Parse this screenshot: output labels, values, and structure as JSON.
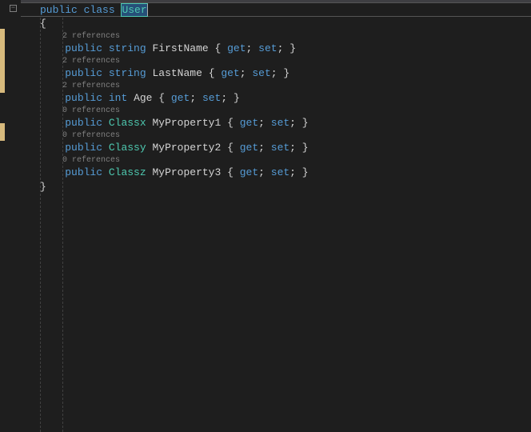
{
  "classDecl": {
    "kw_public": "public",
    "kw_class": "class",
    "name": "User"
  },
  "braceOpen": "{",
  "braceClose": "}",
  "properties": [
    {
      "refs": "2 references",
      "access": "public",
      "type": "string",
      "typeClass": "type",
      "name": "FirstName",
      "get": "get",
      "set": "set"
    },
    {
      "refs": "2 references",
      "access": "public",
      "type": "string",
      "typeClass": "type",
      "name": "LastName",
      "get": "get",
      "set": "set"
    },
    {
      "refs": "2 references",
      "access": "public",
      "type": "int",
      "typeClass": "type",
      "name": "Age",
      "get": "get",
      "set": "set"
    },
    {
      "refs": "0 references",
      "access": "public",
      "type": "Classx",
      "typeClass": "cls",
      "name": "MyProperty1",
      "get": "get",
      "set": "set"
    },
    {
      "refs": "0 references",
      "access": "public",
      "type": "Classy",
      "typeClass": "cls",
      "name": "MyProperty2",
      "get": "get",
      "set": "set"
    },
    {
      "refs": "0 references",
      "access": "public",
      "type": "Classz",
      "typeClass": "cls",
      "name": "MyProperty3",
      "get": "get",
      "set": "set"
    }
  ],
  "foldGlyph": "−"
}
